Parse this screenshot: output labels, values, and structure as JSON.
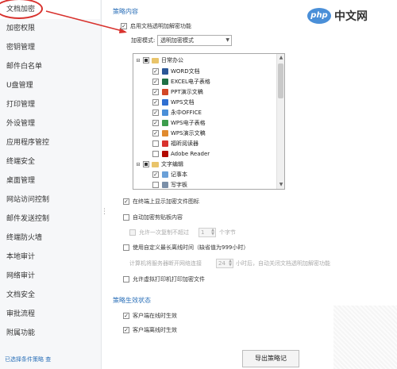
{
  "sidebar": {
    "items": [
      {
        "label": "文档加密",
        "active": true
      },
      {
        "label": "加密权限"
      },
      {
        "label": "密钥管理"
      },
      {
        "label": "邮件白名单"
      },
      {
        "label": "U盘管理"
      },
      {
        "label": "打印管理"
      },
      {
        "label": "外设管理"
      },
      {
        "label": "应用程序管控"
      },
      {
        "label": "终端安全"
      },
      {
        "label": "桌面管理"
      },
      {
        "label": "网站访问控制"
      },
      {
        "label": "邮件发送控制"
      },
      {
        "label": "终端防火墙"
      },
      {
        "label": "本地审计"
      },
      {
        "label": "网络审计"
      },
      {
        "label": "文档安全"
      },
      {
        "label": "审批流程"
      },
      {
        "label": "附属功能"
      }
    ],
    "footer_link": "已选择条件策略 查"
  },
  "main": {
    "policy_section_title": "策略内容",
    "enable_transparent": "启用文档透明加解密功能",
    "mode_label": "加密模式:",
    "mode_value": "透明加密模式",
    "tree": [
      {
        "label": "日常办公",
        "type": "group",
        "expanded": true
      },
      {
        "label": "WORD文档",
        "checked": true,
        "color": "#2b5797"
      },
      {
        "label": "EXCEL电子表格",
        "checked": true,
        "color": "#1e7145"
      },
      {
        "label": "PPT演示文稿",
        "checked": true,
        "color": "#d24726"
      },
      {
        "label": "WPS文档",
        "checked": true,
        "color": "#2f6fd1"
      },
      {
        "label": "永中OFFICE",
        "checked": true,
        "color": "#4a8fd8"
      },
      {
        "label": "WPS电子表格",
        "checked": true,
        "color": "#3c9d4c"
      },
      {
        "label": "WPS演示文稿",
        "checked": true,
        "color": "#e08a2e"
      },
      {
        "label": "福昕阅读器",
        "checked": false,
        "color": "#d8322e"
      },
      {
        "label": "Adobe Reader",
        "checked": false,
        "color": "#b30b00"
      },
      {
        "label": "文字编辑",
        "type": "group",
        "expanded": true
      },
      {
        "label": "记事本",
        "checked": true,
        "color": "#6aa0d8"
      },
      {
        "label": "写字板",
        "checked": false,
        "color": "#7a8fa8"
      }
    ],
    "opt_show_icon": "在终端上显示加密文件图标",
    "opt_auto_clipboard": "自动加密剪贴板内容",
    "opt_paste_limit_prefix": "允许一次复制不超过",
    "opt_paste_limit_value": "1",
    "opt_paste_limit_suffix": "个字节",
    "opt_offline": "使用自定义最长离线时间（缺省值为999小时）",
    "offline_prefix": "计算机将服务器断开网络连接",
    "offline_value": "24",
    "offline_suffix": "小时后，自动关闭文档透明加解密功能",
    "opt_virtual_printer": "允许虚拟打印机打印加密文件",
    "effective_section_title": "策略生效状态",
    "eff_online": "客户端在线时生效",
    "eff_offline": "客户端离线时生效",
    "export_button": "导出策略记"
  },
  "logo": {
    "badge": "php",
    "text": "中文网"
  }
}
